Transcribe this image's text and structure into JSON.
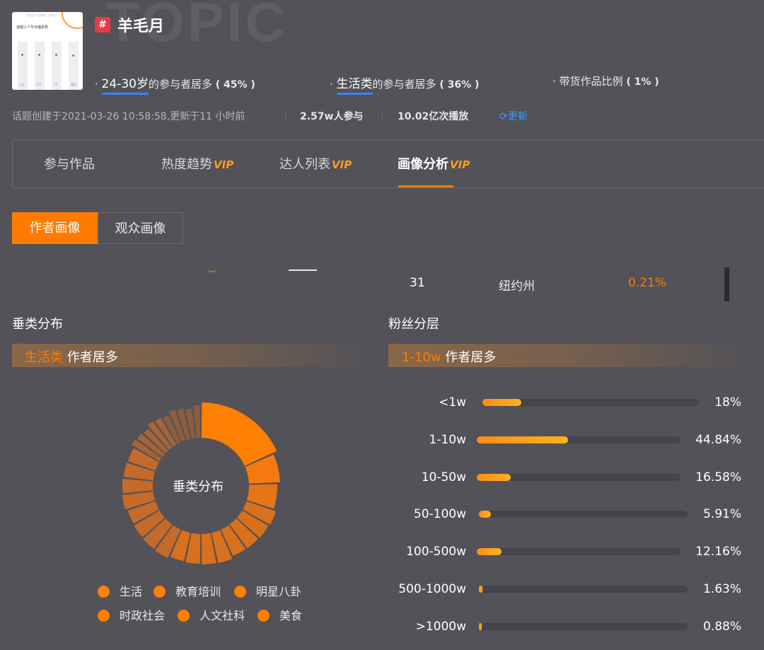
{
  "topic": {
    "hash": "#",
    "title": "羊毛月",
    "watermark": "TOPIC",
    "thumbnail": {
      "title": "话题三个月日播走势",
      "top_text": "出现这个话题的…使用了",
      "corner": "流量走",
      "x_labels": [
        "1月",
        "2月",
        "3月",
        "最近"
      ]
    }
  },
  "stats": [
    {
      "highlight": "24-30岁",
      "text": "的参与者居多",
      "pct": "( 45% )"
    },
    {
      "highlight": "生活类",
      "text": "的参与者居多",
      "pct": "( 36% )"
    },
    {
      "highlight": "",
      "text": "带货作品比例",
      "pct": "( 1% )"
    }
  ],
  "meta": {
    "created": "话题创建于2021-03-26 10:58:58,更新于11 小时前",
    "participants": "2.57w人参与",
    "plays": "10.02亿次播放",
    "refresh": "更新"
  },
  "tabs": [
    {
      "label": "参与作品",
      "vip": ""
    },
    {
      "label": "热度趋势",
      "vip": "VIP"
    },
    {
      "label": "达人列表",
      "vip": "VIP"
    },
    {
      "label": "画像分析",
      "vip": "VIP",
      "active": true
    }
  ],
  "segmented": {
    "on": "作者画像",
    "off": "观众画像"
  },
  "region_row": {
    "rank": "31",
    "name": "纽约州",
    "pct": "0.21%"
  },
  "category": {
    "title": "垂类分布",
    "band_highlight": "生活类",
    "band_text": " 作者居多",
    "center": "垂类分布",
    "legend": [
      "生活",
      "教育培训",
      "明星八卦",
      "时政社会",
      "人文社科",
      "美食"
    ]
  },
  "fans": {
    "title": "粉丝分层",
    "band_highlight": "1-10w",
    "band_text": " 作者居多",
    "rows": [
      {
        "label": "<1w",
        "value": "18%",
        "fraction": 0.18
      },
      {
        "label": "1-10w",
        "value": "44.84%",
        "fraction": 0.4484
      },
      {
        "label": "10-50w",
        "value": "16.58%",
        "fraction": 0.1658
      },
      {
        "label": "50-100w",
        "value": "5.91%",
        "fraction": 0.0591
      },
      {
        "label": "100-500w",
        "value": "12.16%",
        "fraction": 0.1216
      },
      {
        "label": "500-1000w",
        "value": "1.63%",
        "fraction": 0.0163
      },
      {
        "label": ">1000w",
        "value": "0.88%",
        "fraction": 0.0088
      }
    ]
  },
  "colors": {
    "accent": "#ff7a00",
    "link": "#3a9bff",
    "tag": "#e63946"
  }
}
